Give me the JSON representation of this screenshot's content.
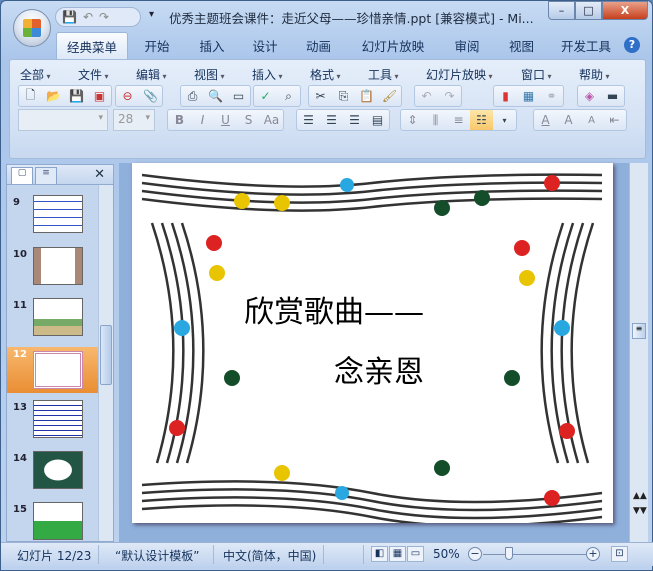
{
  "window": {
    "title": "优秀主题班会课件：走近父母——珍惜亲情.ppt [兼容模式] - Mi...",
    "minimize": "–",
    "maximize": "□",
    "close": "X"
  },
  "qat": {
    "save": "💾",
    "undo": "↶",
    "redo": "↷",
    "customize": "▾"
  },
  "tabs": [
    {
      "label": "经典菜单",
      "active": true
    },
    {
      "label": "开始"
    },
    {
      "label": "插入"
    },
    {
      "label": "设计"
    },
    {
      "label": "动画"
    },
    {
      "label": "幻灯片放映"
    },
    {
      "label": "审阅"
    },
    {
      "label": "视图"
    },
    {
      "label": "开发工具"
    }
  ],
  "help": "?",
  "menus": [
    "全部",
    "文件",
    "编辑",
    "视图",
    "插入",
    "格式",
    "工具",
    "幻灯片放映",
    "窗口",
    "帮助"
  ],
  "font": {
    "name": "",
    "size": "28"
  },
  "format_buttons": [
    "B",
    "I",
    "U",
    "S",
    "Aa"
  ],
  "panel": {
    "close": "✕",
    "thumbnails": [
      {
        "n": "9"
      },
      {
        "n": "10"
      },
      {
        "n": "11"
      },
      {
        "n": "12",
        "selected": true
      },
      {
        "n": "13"
      },
      {
        "n": "14"
      },
      {
        "n": "15"
      }
    ]
  },
  "slide": {
    "title": "欣赏歌曲——",
    "subtitle": "念亲恩"
  },
  "status": {
    "slide": "幻灯片 12/23",
    "template": "“默认设计模板”",
    "language": "中文(简体，中国)",
    "zoom": "50%"
  }
}
